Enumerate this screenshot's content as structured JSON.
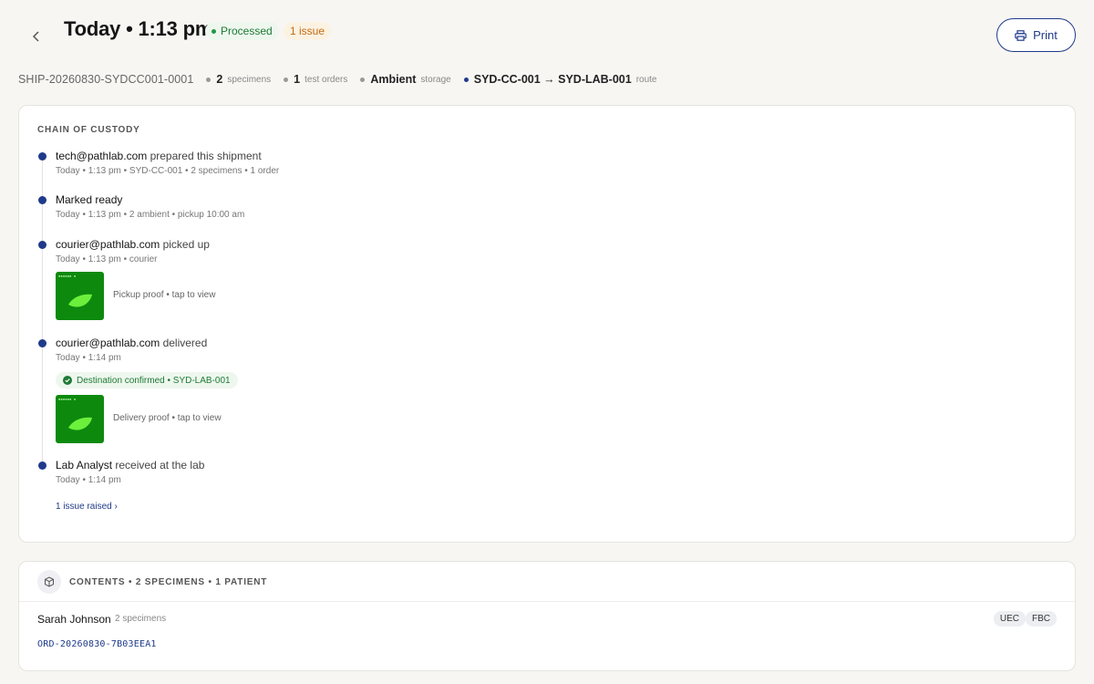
{
  "header": {
    "title": "Today • 1:13 pm",
    "status_badge": "Processed",
    "issue_badge": "1 issue",
    "print_label": "Print"
  },
  "meta": {
    "shipment_id": "SHIP-20260830-SYDCC001-0001",
    "specimens_count": "2",
    "specimens_label": "specimens",
    "test_orders_count": "1",
    "test_orders_label": "test orders",
    "storage_value": "Ambient",
    "storage_label": "storage",
    "route_value": "SYD-CC-001 → SYD-LAB-001",
    "route_label": "route"
  },
  "custody": {
    "section_title": "CHAIN OF CUSTODY",
    "events": [
      {
        "actor": "tech@pathlab.com",
        "action": " prepared this shipment",
        "detail": "Today • 1:13 pm • SYD-CC-001 • 2 specimens • 1 order"
      },
      {
        "actor": "Marked ready",
        "action": "",
        "detail": "Today • 1:13 pm • 2 ambient • pickup 10:00 am"
      },
      {
        "actor": "courier@pathlab.com",
        "action": " picked up",
        "detail": "Today • 1:13 pm • courier",
        "proof_caption": "Pickup proof • tap to view"
      },
      {
        "actor": "courier@pathlab.com",
        "action": " delivered",
        "detail": "Today • 1:14 pm",
        "confirmation": "Destination confirmed • SYD-LAB-001",
        "proof_caption": "Delivery proof • tap to view"
      },
      {
        "actor": "Lab Analyst",
        "action": " received at the lab",
        "detail": "Today • 1:14 pm"
      }
    ],
    "issue_link": "1 issue raised ›"
  },
  "contents": {
    "section_title": "CONTENTS • 2 SPECIMENS • 1 PATIENT",
    "patient_name": "Sarah Johnson",
    "patient_specimens": "2 specimens",
    "order_id": "ORD-20260830-7B03EEA1",
    "tags": [
      "UEC",
      "FBC"
    ]
  },
  "colors": {
    "accent": "#1f3a8a",
    "success": "#1e7a35",
    "warning": "#c46a10",
    "proof_bg": "#0d8a0d"
  }
}
